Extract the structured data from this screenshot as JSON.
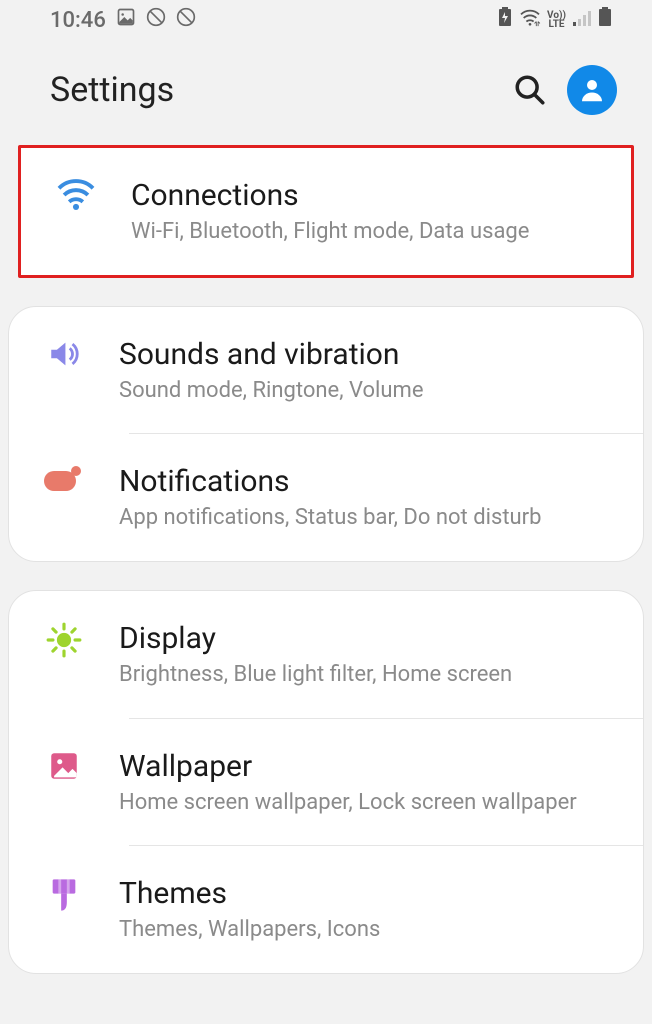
{
  "statusBar": {
    "time": "10:46"
  },
  "header": {
    "title": "Settings"
  },
  "groups": [
    {
      "highlighted": true,
      "items": [
        {
          "key": "connections",
          "title": "Connections",
          "subtitle": "Wi-Fi, Bluetooth, Flight mode, Data usage"
        }
      ]
    },
    {
      "highlighted": false,
      "items": [
        {
          "key": "sounds",
          "title": "Sounds and vibration",
          "subtitle": "Sound mode, Ringtone, Volume"
        },
        {
          "key": "notifications",
          "title": "Notifications",
          "subtitle": "App notifications, Status bar, Do not disturb"
        }
      ]
    },
    {
      "highlighted": false,
      "items": [
        {
          "key": "display",
          "title": "Display",
          "subtitle": "Brightness, Blue light filter, Home screen"
        },
        {
          "key": "wallpaper",
          "title": "Wallpaper",
          "subtitle": "Home screen wallpaper, Lock screen wallpaper"
        },
        {
          "key": "themes",
          "title": "Themes",
          "subtitle": "Themes, Wallpapers, Icons"
        }
      ]
    }
  ]
}
